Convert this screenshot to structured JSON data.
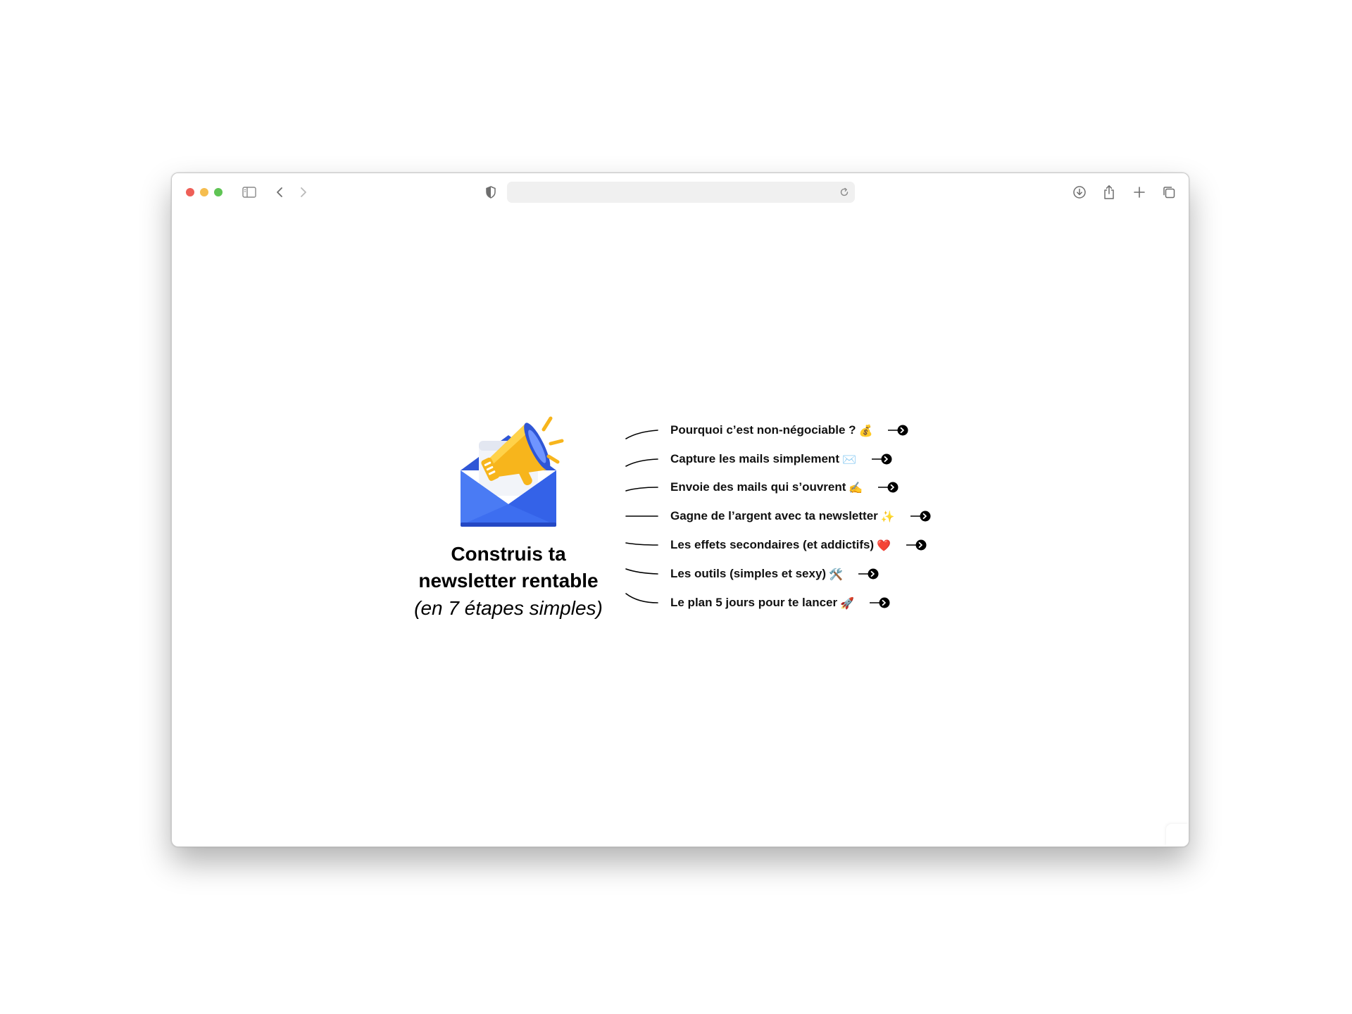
{
  "browser": {
    "traffic_lights": {
      "close": "#ee5f57",
      "minimize": "#f5bd4f",
      "zoom": "#5fc454"
    },
    "url": "",
    "icons": [
      "sidebar-toggle-icon",
      "back-chevron-icon",
      "forward-chevron-icon",
      "privacy-shield-icon",
      "reload-icon",
      "download-icon",
      "share-icon",
      "new-tab-plus-icon",
      "tab-overview-icon"
    ]
  },
  "hero": {
    "title_line1": "Construis ta",
    "title_line2": "newsletter rentable",
    "subtitle": "(en 7 étapes simples)",
    "illustration": "envelope-megaphone-icon"
  },
  "topics": [
    {
      "label": "Pourquoi c’est non-négociable ?",
      "emoji": "💰"
    },
    {
      "label": "Capture les mails simplement",
      "emoji": "✉️"
    },
    {
      "label": "Envoie des mails qui s’ouvrent",
      "emoji": "✍️"
    },
    {
      "label": "Gagne de l’argent avec ta newsletter",
      "emoji": "✨"
    },
    {
      "label": "Les effets secondaires (et addictifs)",
      "emoji": "❤️"
    },
    {
      "label": "Les outils (simples et sexy)",
      "emoji": "🛠️"
    },
    {
      "label": "Le plan 5 jours pour te lancer",
      "emoji": "🚀"
    }
  ],
  "colors": {
    "accent_blue": "#3d6ef0",
    "accent_yellow": "#f7b51c",
    "text": "#000000"
  }
}
